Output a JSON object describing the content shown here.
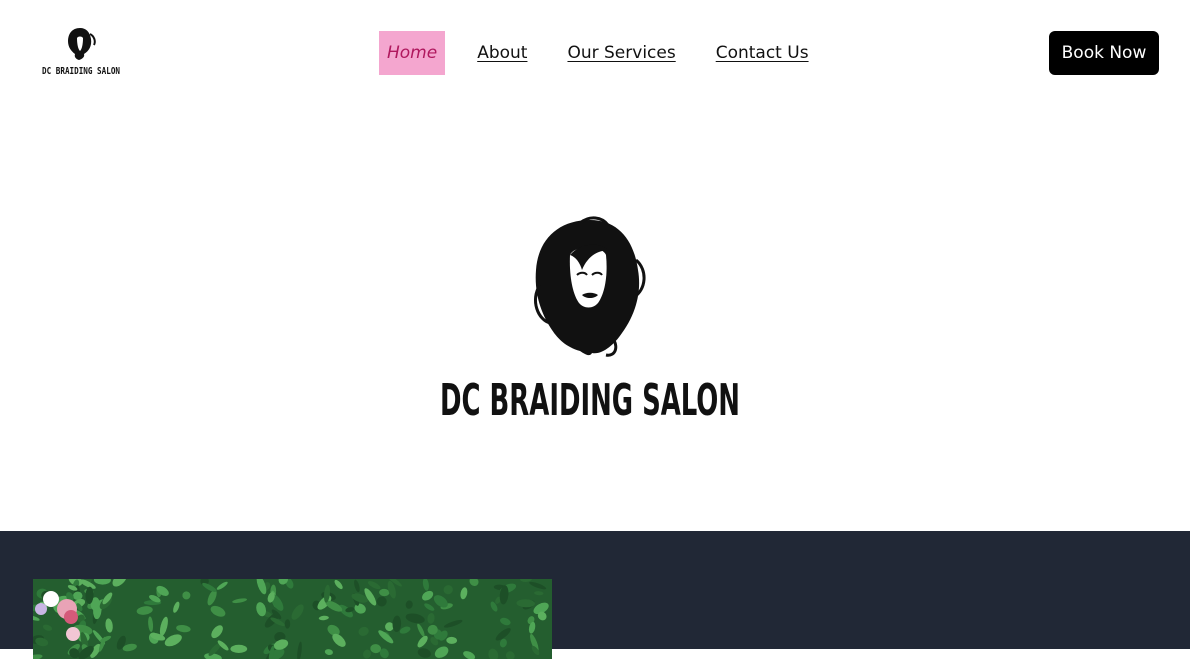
{
  "brand": {
    "name": "DC BRAIDING SALON",
    "logo_icon": "woman-silhouette-logo"
  },
  "nav": {
    "items": [
      {
        "label": "Home",
        "active": true
      },
      {
        "label": "About",
        "active": false
      },
      {
        "label": "Our Services",
        "active": false
      },
      {
        "label": "Contact Us",
        "active": false
      }
    ]
  },
  "header": {
    "cta_label": "Book Now"
  },
  "hero": {
    "title": "DC BRAIDING SALON"
  },
  "colors": {
    "nav_active_bg": "#f4a6cf",
    "nav_active_text": "#b0185e",
    "cta_bg": "#000000",
    "dark_section_bg": "#212836"
  },
  "gallery": {
    "image_subject": "green-leaf-wall-with-flowers"
  }
}
